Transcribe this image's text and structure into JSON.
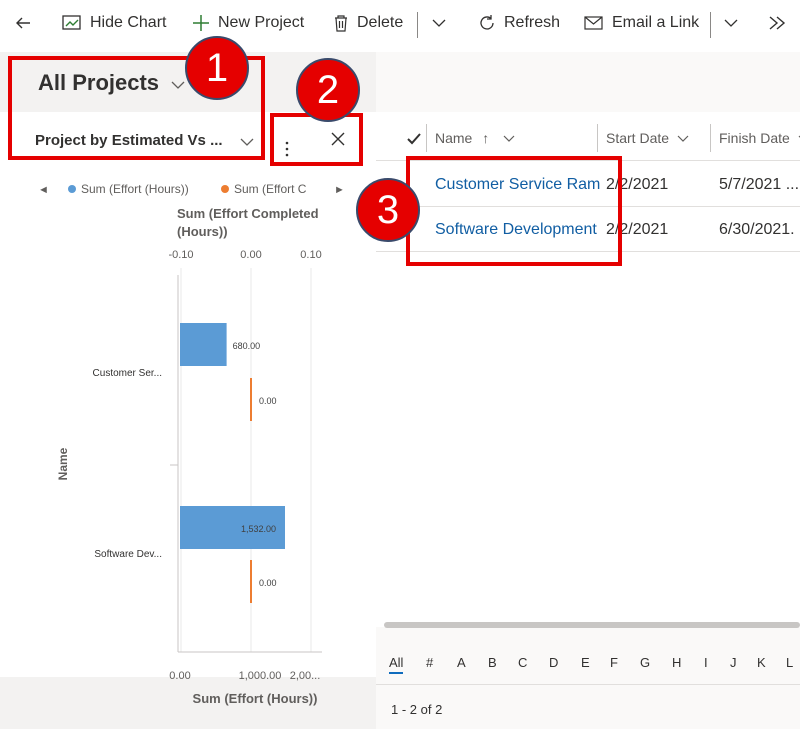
{
  "toolbar": {
    "hide_chart": "Hide Chart",
    "new_project": "New Project",
    "delete": "Delete",
    "refresh": "Refresh",
    "email_link": "Email a Link"
  },
  "view": {
    "title": "All Projects"
  },
  "chart_panel": {
    "title": "Project by Estimated Vs ..."
  },
  "callouts": [
    "1",
    "2",
    "3"
  ],
  "grid": {
    "columns": [
      "Name",
      "Start Date",
      "Finish Date"
    ],
    "rows": [
      {
        "name": "Customer Service Ramp",
        "start": "2/2/2021",
        "finish": "5/7/2021 ..."
      },
      {
        "name": "Software Development",
        "start": "2/2/2021",
        "finish": "6/30/2021."
      }
    ],
    "alphabet": [
      "All",
      "#",
      "A",
      "B",
      "C",
      "D",
      "E",
      "F",
      "G",
      "H",
      "I",
      "J",
      "K",
      "L"
    ],
    "paging": "1 - 2 of 2"
  },
  "colors": {
    "accent_blue": "#5b9bd5",
    "accent_orange": "#ed7d31",
    "callout_red": "#e50000",
    "link": "#115ea3"
  },
  "chart_data": {
    "type": "bar",
    "orientation": "horizontal",
    "legend": [
      "Sum (Effort (Hours))",
      "Sum (Effort C"
    ],
    "top_axis": {
      "label": "Sum (Effort Completed (Hours))",
      "ticks": [
        "-0.10",
        "0.00",
        "0.10"
      ]
    },
    "bottom_axis": {
      "label": "Sum (Effort (Hours))",
      "ticks": [
        "0.00",
        "1,000.00",
        "2,00..."
      ]
    },
    "ylabel": "Name",
    "categories": [
      "Customer Ser...",
      "Software Dev..."
    ],
    "series": [
      {
        "name": "Sum (Effort (Hours))",
        "values": [
          680,
          1532
        ],
        "labels": [
          "680.00",
          "1,532.00"
        ]
      },
      {
        "name": "Sum (Effort C",
        "values": [
          0,
          0
        ],
        "labels": [
          "0.00",
          "0.00"
        ]
      }
    ],
    "xlim": [
      0,
      2100
    ]
  }
}
